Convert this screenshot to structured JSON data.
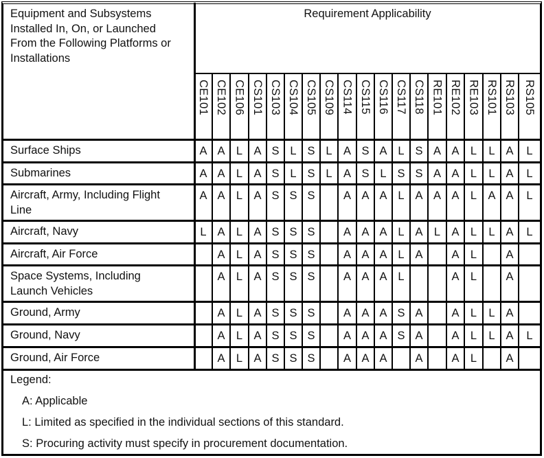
{
  "table": {
    "row_header": "Equipment and Subsystems Installed In, On, or Launched From the Following Platforms or Installations",
    "row_header_lines": [
      "Equipment and Subsystems",
      "Installed In, On, or Launched",
      "From the Following Platforms or",
      "Installations"
    ],
    "group_header": "Requirement Applicability",
    "columns": [
      "CE101",
      "CE102",
      "CE106",
      "CS101",
      "CS103",
      "CS104",
      "CS105",
      "CS109",
      "CS114",
      "CS115",
      "CS116",
      "CS117",
      "CS118",
      "RE101",
      "RE102",
      "RE103",
      "RS101",
      "RS103",
      "RS105"
    ],
    "rows": [
      {
        "label_lines": [
          "Surface Ships"
        ],
        "values": [
          "A",
          "A",
          "L",
          "A",
          "S",
          "L",
          "S",
          "L",
          "A",
          "S",
          "A",
          "L",
          "S",
          "A",
          "A",
          "L",
          "L",
          "A",
          "L"
        ]
      },
      {
        "label_lines": [
          "Submarines"
        ],
        "values": [
          "A",
          "A",
          "L",
          "A",
          "S",
          "L",
          "S",
          "L",
          "A",
          "S",
          "L",
          "S",
          "S",
          "A",
          "A",
          "L",
          "L",
          "A",
          "L"
        ]
      },
      {
        "label_lines": [
          "Aircraft, Army, Including Flight",
          "Line"
        ],
        "values": [
          "A",
          "A",
          "L",
          "A",
          "S",
          "S",
          "S",
          "",
          "A",
          "A",
          "A",
          "L",
          "A",
          "A",
          "A",
          "L",
          "A",
          "A",
          "L"
        ]
      },
      {
        "label_lines": [
          "Aircraft, Navy"
        ],
        "values": [
          "L",
          "A",
          "L",
          "A",
          "S",
          "S",
          "S",
          "",
          "A",
          "A",
          "A",
          "L",
          "A",
          "L",
          "A",
          "L",
          "L",
          "A",
          "L"
        ]
      },
      {
        "label_lines": [
          "Aircraft, Air Force"
        ],
        "values": [
          "",
          "A",
          "L",
          "A",
          "S",
          "S",
          "S",
          "",
          "A",
          "A",
          "A",
          "L",
          "A",
          "",
          "A",
          "L",
          "",
          "A",
          ""
        ]
      },
      {
        "label_lines": [
          "Space Systems, Including",
          "Launch Vehicles"
        ],
        "values": [
          "",
          "A",
          "L",
          "A",
          "S",
          "S",
          "S",
          "",
          "A",
          "A",
          "A",
          "L",
          "",
          "",
          "A",
          "L",
          "",
          "A",
          ""
        ]
      },
      {
        "label_lines": [
          "Ground, Army"
        ],
        "values": [
          "",
          "A",
          "L",
          "A",
          "S",
          "S",
          "S",
          "",
          "A",
          "A",
          "A",
          "S",
          "A",
          "",
          "A",
          "L",
          "L",
          "A",
          ""
        ]
      },
      {
        "label_lines": [
          "Ground, Navy"
        ],
        "values": [
          "",
          "A",
          "L",
          "A",
          "S",
          "S",
          "S",
          "",
          "A",
          "A",
          "A",
          "S",
          "A",
          "",
          "A",
          "L",
          "L",
          "A",
          "L"
        ]
      },
      {
        "label_lines": [
          "Ground, Air Force"
        ],
        "values": [
          "",
          "A",
          "L",
          "A",
          "S",
          "S",
          "S",
          "",
          "A",
          "A",
          "A",
          "",
          "A",
          "",
          "A",
          "L",
          "",
          "A",
          ""
        ]
      }
    ]
  },
  "legend": {
    "title": "Legend:",
    "items": [
      {
        "code": "A:",
        "text": "Applicable"
      },
      {
        "code": "L:",
        "text": "Limited as specified in the individual sections of this standard."
      },
      {
        "code": "S:",
        "text": "Procuring activity must specify in procurement documentation."
      }
    ]
  }
}
